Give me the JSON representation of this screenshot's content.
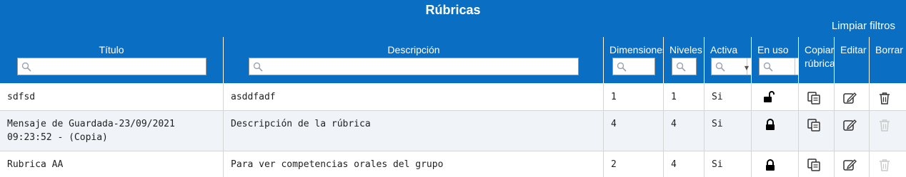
{
  "header": {
    "title": "Rúbricas",
    "clear_filters": "Limpiar filtros"
  },
  "columns": {
    "titulo": "Título",
    "descripcion": "Descripción",
    "dimensiones": "Dimensiones",
    "niveles": "Niveles",
    "activa": "Activa",
    "en_uso": "En uso",
    "copiar": "Copiar rúbrica",
    "editar": "Editar",
    "borrar": "Borrar"
  },
  "icons": {
    "search": "search-icon",
    "unlocked": "lock-open-icon",
    "locked": "lock-icon",
    "copy": "copy-icon",
    "edit": "edit-icon",
    "delete": "trash-icon"
  },
  "colors": {
    "header_bg": "#0a6fc2",
    "row_alt_bg": "#f0f3f7",
    "disabled_icon": "#c9c9c9"
  },
  "rows": [
    {
      "titulo_1": "sdfsd",
      "titulo_2": "",
      "descripcion": "asddfadf",
      "dimensiones": "1",
      "niveles": "1",
      "activa": "Si",
      "en_uso": "unlocked",
      "delete_enabled": true
    },
    {
      "titulo_1": "Mensaje de Guardada-23/09/2021",
      "titulo_2": "09:23:52 - (Copia)",
      "descripcion": "Descripción de la rúbrica",
      "dimensiones": "4",
      "niveles": "4",
      "activa": "Si",
      "en_uso": "locked",
      "delete_enabled": false
    },
    {
      "titulo_1": "Rubrica AA",
      "titulo_2": "",
      "descripcion": "Para ver competencias orales del grupo",
      "dimensiones": "2",
      "niveles": "4",
      "activa": "Si",
      "en_uso": "locked",
      "delete_enabled": false
    }
  ]
}
